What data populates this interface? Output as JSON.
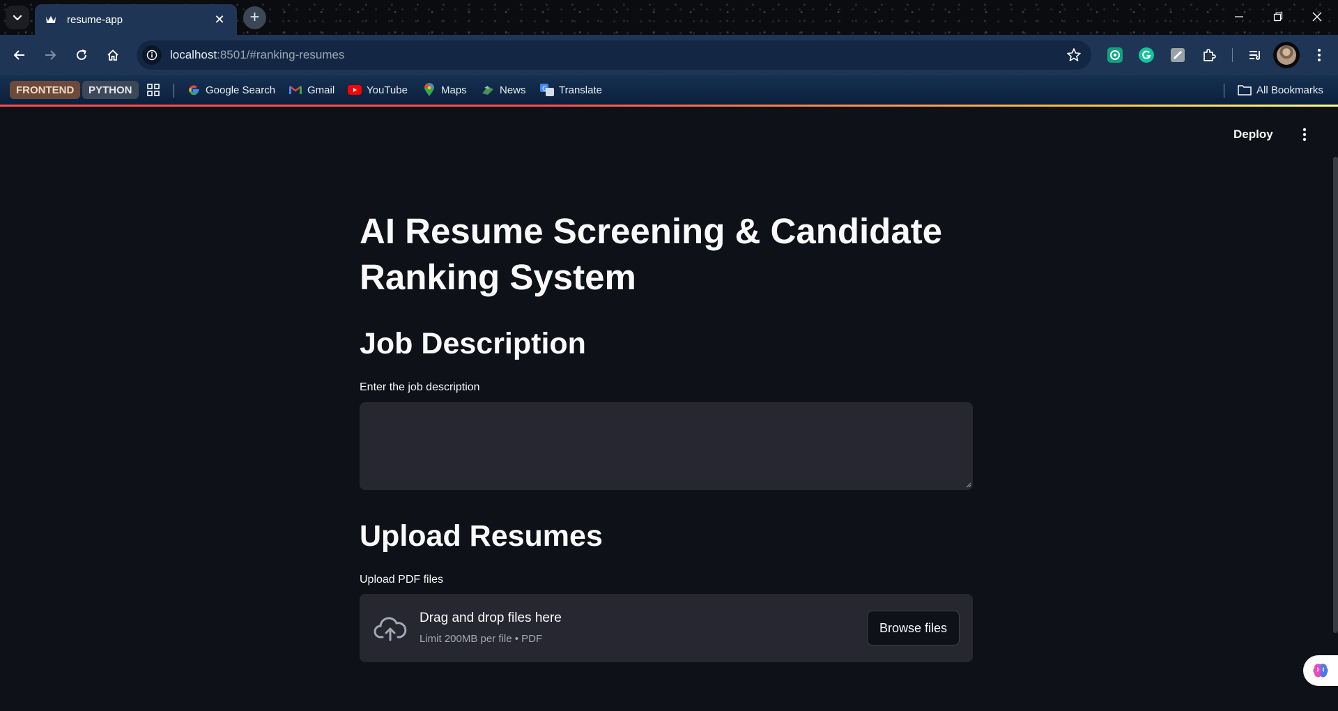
{
  "browser": {
    "tab_title": "resume-app",
    "tab_close": "✕",
    "new_tab": "+",
    "url_host": "localhost",
    "url_rest": ":8501/#ranking-resumes"
  },
  "bookmarks": {
    "chips": [
      {
        "label": "FRONTEND",
        "bg": "#6b4a3a",
        "fg": "#f4d9c6"
      },
      {
        "label": "PYTHON",
        "bg": "#3c4757",
        "fg": "#e2e7ee"
      }
    ],
    "items": [
      {
        "label": "Google Search",
        "icon": "google-icon"
      },
      {
        "label": "Gmail",
        "icon": "gmail-icon"
      },
      {
        "label": "YouTube",
        "icon": "youtube-icon"
      },
      {
        "label": "Maps",
        "icon": "maps-icon"
      },
      {
        "label": "News",
        "icon": "news-icon"
      },
      {
        "label": "Translate",
        "icon": "translate-icon"
      }
    ],
    "all_bookmarks": "All Bookmarks"
  },
  "app": {
    "deploy": "Deploy",
    "title": "AI Resume Screening & Candidate Ranking System",
    "job_section": "Job Description",
    "job_label": "Enter the job description",
    "job_value": "",
    "upload_section": "Upload Resumes",
    "upload_label": "Upload PDF files",
    "dropzone_title": "Drag and drop files here",
    "dropzone_sub": "Limit 200MB per file • PDF",
    "browse_button": "Browse files"
  },
  "colors": {
    "background": "#0e1117",
    "input_bg": "#262730",
    "accent_red": "#ff4b4b",
    "tab_bg": "#1f3556"
  }
}
